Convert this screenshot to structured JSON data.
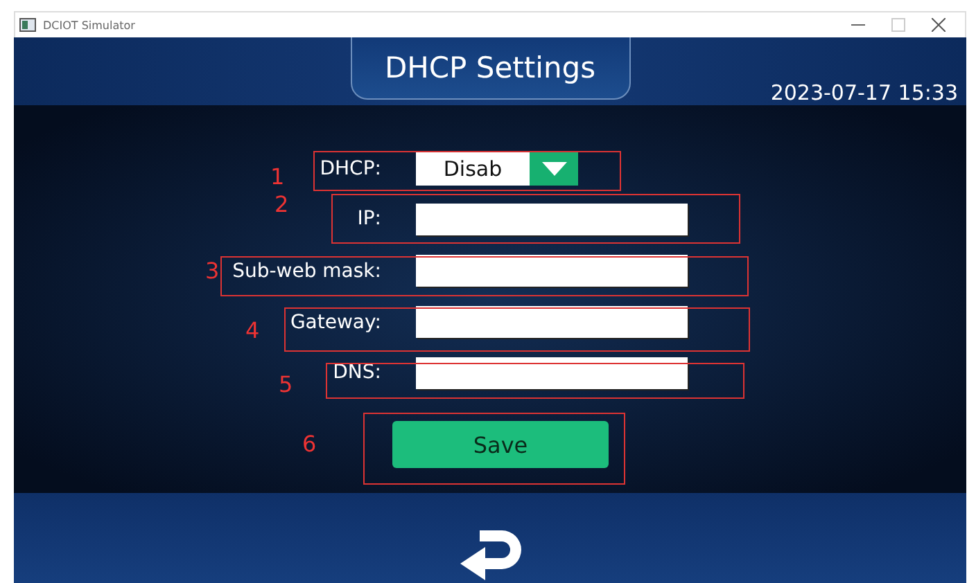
{
  "window": {
    "title": "DCIOT Simulator"
  },
  "header": {
    "title": "DHCP Settings",
    "datetime": "2023-07-17 15:33"
  },
  "fields": [
    {
      "kind": "dropdown",
      "label": "DHCP:",
      "value": "Disab",
      "annotation": "1"
    },
    {
      "kind": "text",
      "label": "IP:",
      "annotation": "2"
    },
    {
      "kind": "text",
      "label": "Sub-web mask:",
      "annotation": "3"
    },
    {
      "kind": "text",
      "label": "Gateway:",
      "annotation": "4"
    },
    {
      "kind": "text",
      "label": "DNS:",
      "annotation": "5"
    }
  ],
  "save_button": {
    "label": "Save",
    "annotation": "6"
  }
}
